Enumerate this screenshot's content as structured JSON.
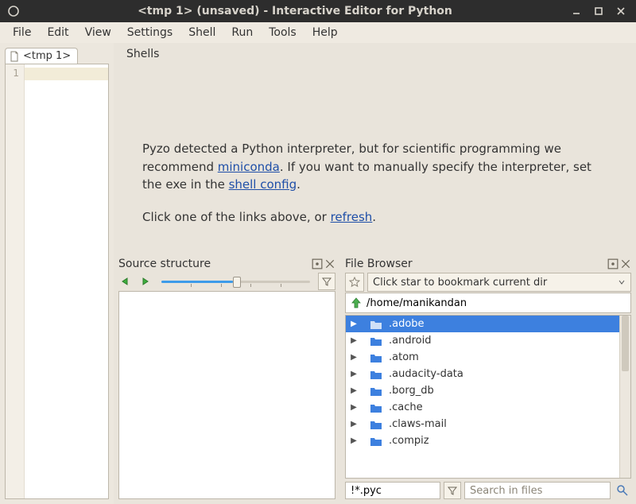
{
  "window": {
    "title": "<tmp 1> (unsaved) - Interactive Editor for Python"
  },
  "menu": [
    "File",
    "Edit",
    "View",
    "Settings",
    "Shell",
    "Run",
    "Tools",
    "Help"
  ],
  "editor": {
    "tab_label": "<tmp 1>",
    "line_numbers": [
      "1"
    ]
  },
  "shells": {
    "title": "Shells",
    "msg_part1": "Pyzo detected a Python interpreter, but for scientific programming we recommend ",
    "link_miniconda": "miniconda",
    "msg_part2": ". If you want to manually specify the interpreter, set the exe in the ",
    "link_shellconfig": "shell config",
    "msg_part3": ".",
    "msg2_part1": "Click one of the links above, or ",
    "link_refresh": "refresh",
    "msg2_part2": "."
  },
  "structure": {
    "title": "Source structure"
  },
  "filebrowser": {
    "title": "File Browser",
    "bookmark_placeholder": "Click star to bookmark current dir",
    "path": "/home/manikandan",
    "pattern": "!*.pyc",
    "search_placeholder": "Search in files",
    "items": [
      ".adobe",
      ".android",
      ".atom",
      ".audacity-data",
      ".borg_db",
      ".cache",
      ".claws-mail",
      ".compiz"
    ],
    "selected_index": 0
  }
}
